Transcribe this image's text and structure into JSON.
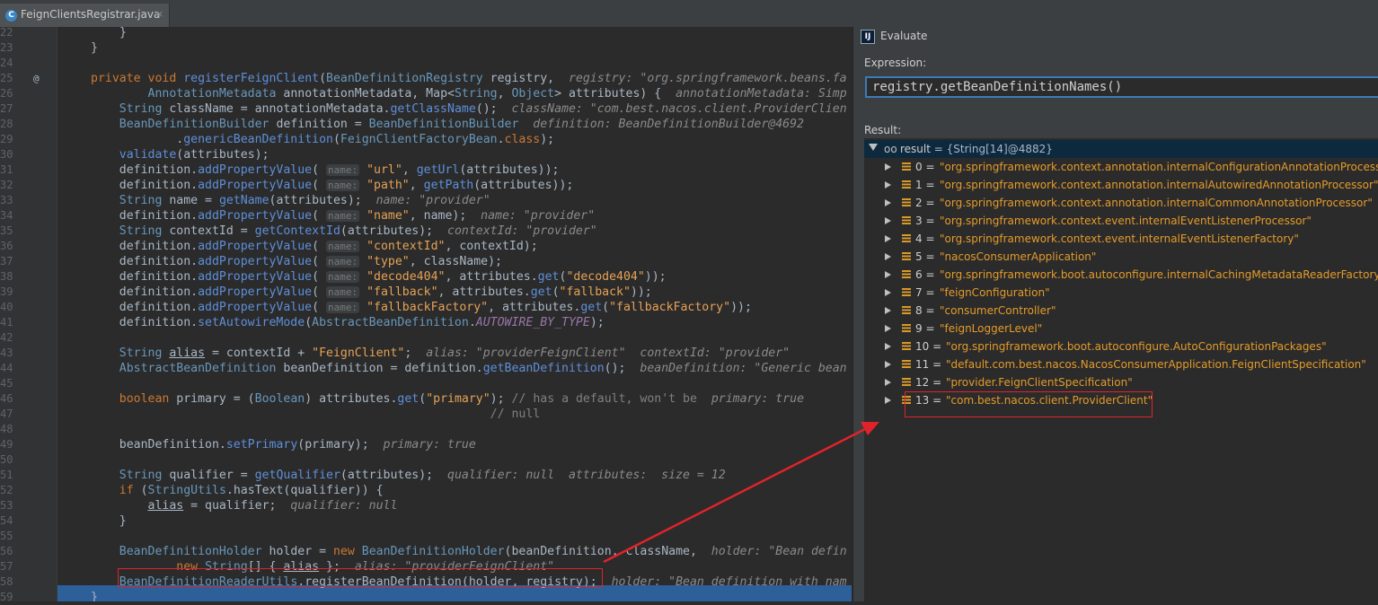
{
  "editor": {
    "tab_title": "FeignClientsRegistrar.java",
    "tab_icon_letter": "C",
    "tab_close": "×",
    "at_marker": "@",
    "lines": [
      {
        "n": "22",
        "html": "<span>}</span>"
      },
      {
        "n": "23",
        "html": "<span>}</span>"
      },
      {
        "n": "24",
        "html": ""
      },
      {
        "n": "25",
        "html": "<span class='kw'>private void </span><span class='fn'>registerFeignClient</span>(<span class='typ'>BeanDefinitionRegistry</span> registry,  <span class='it'>registry: \"org.springframework.beans.fa</span>"
      },
      {
        "n": "26",
        "html": "        <span class='typ'>AnnotationMetadata</span> annotationMetadata, Map&lt;<span class='typ'>String</span>, <span class='typ'>Object</span>&gt; attributes) {  <span class='it'>annotationMetadata: Simp</span>"
      },
      {
        "n": "27",
        "html": "    <span class='typ'>String</span> className = annotationMetadata.<span class='fn'>getClassName</span>();  <span class='it'>className: \"com.best.nacos.client.ProviderClien</span>"
      },
      {
        "n": "28",
        "html": "    <span class='typ'>BeanDefinitionBuilder</span> definition = <span class='typ'>BeanDefinitionBuilder</span>  <span class='it'>definition: BeanDefinitionBuilder@4692</span>"
      },
      {
        "n": "29",
        "html": "            .<span class='fn'>genericBeanDefinition</span>(<span class='typ'>FeignClientFactoryBean</span>.<span class='kw'>class</span>);"
      },
      {
        "n": "30",
        "html": "    <span class='fn'>validate</span>(attributes);"
      },
      {
        "n": "31",
        "html": "    definition.<span class='fn'>addPropertyValue</span>( <span class='hint'>name:</span> <span class='str'>\"url\"</span>, <span class='fn'>getUrl</span>(attributes));"
      },
      {
        "n": "32",
        "html": "    definition.<span class='fn'>addPropertyValue</span>( <span class='hint'>name:</span> <span class='str'>\"path\"</span>, <span class='fn'>getPath</span>(attributes));"
      },
      {
        "n": "33",
        "html": "    <span class='typ'>String</span> name = <span class='fn'>getName</span>(attributes);  <span class='it'>name: \"provider\"</span>"
      },
      {
        "n": "34",
        "html": "    definition.<span class='fn'>addPropertyValue</span>( <span class='hint'>name:</span> <span class='str'>\"name\"</span>, name);  <span class='it'>name: \"provider\"</span>"
      },
      {
        "n": "35",
        "html": "    <span class='typ'>String</span> contextId = <span class='fn'>getContextId</span>(attributes);  <span class='it'>contextId: \"provider\"</span>"
      },
      {
        "n": "36",
        "html": "    definition.<span class='fn'>addPropertyValue</span>( <span class='hint'>name:</span> <span class='str'>\"contextId\"</span>, contextId);"
      },
      {
        "n": "37",
        "html": "    definition.<span class='fn'>addPropertyValue</span>( <span class='hint'>name:</span> <span class='str'>\"type\"</span>, className);"
      },
      {
        "n": "38",
        "html": "    definition.<span class='fn'>addPropertyValue</span>( <span class='hint'>name:</span> <span class='str'>\"decode404\"</span>, attributes.<span class='fn'>get</span>(<span class='str'>\"decode404\"</span>));"
      },
      {
        "n": "39",
        "html": "    definition.<span class='fn'>addPropertyValue</span>( <span class='hint'>name:</span> <span class='str'>\"fallback\"</span>, attributes.<span class='fn'>get</span>(<span class='str'>\"fallback\"</span>));"
      },
      {
        "n": "40",
        "html": "    definition.<span class='fn'>addPropertyValue</span>( <span class='hint'>name:</span> <span class='str'>\"fallbackFactory\"</span>, attributes.<span class='fn'>get</span>(<span class='str'>\"fallbackFactory\"</span>));"
      },
      {
        "n": "41",
        "html": "    definition.<span class='fn'>setAutowireMode</span>(<span class='typ'>AbstractBeanDefinition</span>.<span class='cst'>AUTOWIRE_BY_TYPE</span>);"
      },
      {
        "n": "42",
        "html": ""
      },
      {
        "n": "43",
        "html": "    <span class='typ'>String</span> <span class='ul'>alias</span> = contextId + <span class='str'>\"FeignClient\"</span>;  <span class='it'>alias: \"providerFeignClient\"  contextId: \"provider\"</span>"
      },
      {
        "n": "44",
        "html": "    <span class='typ'>AbstractBeanDefinition</span> beanDefinition = definition.<span class='fn'>getBeanDefinition</span>();  <span class='it'>beanDefinition: \"Generic bean</span>"
      },
      {
        "n": "45",
        "html": ""
      },
      {
        "n": "46",
        "html": "    <span class='kw'>boolean</span> primary = (<span class='typ'>Boolean</span>) attributes.<span class='fn'>get</span>(<span class='str'>\"primary\"</span>); <span class='cm'>// has a default, won't be</span>  <span class='it'>primary: true</span>"
      },
      {
        "n": "47",
        "html": "                                                        <span class='cm'>// null</span>"
      },
      {
        "n": "48",
        "html": ""
      },
      {
        "n": "49",
        "html": "    beanDefinition.<span class='fn'>setPrimary</span>(primary);  <span class='it'>primary: true</span>"
      },
      {
        "n": "50",
        "html": ""
      },
      {
        "n": "51",
        "html": "    <span class='typ'>String</span> qualifier = <span class='fn'>getQualifier</span>(attributes);  <span class='it'>qualifier: null  attributes:  size = 12</span>"
      },
      {
        "n": "52",
        "html": "    <span class='kw'>if</span> (<span class='typ'>StringUtils</span>.hasText(qualifier)) {"
      },
      {
        "n": "53",
        "html": "        <span class='ul'>alias</span> = qualifier;  <span class='it'>qualifier: null</span>"
      },
      {
        "n": "54",
        "html": "    }"
      },
      {
        "n": "55",
        "html": ""
      },
      {
        "n": "56",
        "html": "    <span class='typ'>BeanDefinitionHolder</span> holder = <span class='kw'>new</span> <span class='typ'>BeanDefinitionHolder</span>(beanDefinition, className,  <span class='it'>holder: \"Bean defin</span>"
      },
      {
        "n": "57",
        "html": "            <span class='kw'>new</span> <span class='typ'>String</span>[] { <span class='ul'>alias</span> };  <span class='it'>alias: \"providerFeignClient\"</span>"
      },
      {
        "n": "58",
        "html": "    <span class='typ'>BeanDefinitionReaderUtils</span>.registerBeanDefinition(holder, registry);  <span class='it'>holder: \"Bean definition with nam</span>"
      },
      {
        "n": "59",
        "html": "}"
      }
    ]
  },
  "evaluate": {
    "title": "Evaluate",
    "app_icon_text": "IJ",
    "expression_label": "Expression:",
    "expression_value": "registry.getBeanDefinitionNames()",
    "result_label": "Result:",
    "result_icon": "oo",
    "result_name": "result",
    "result_value": " = {String[14]@4882}",
    "items": [
      {
        "index": "0 = ",
        "value": "\"org.springframework.context.annotation.internalConfigurationAnnotationProcessor\""
      },
      {
        "index": "1 = ",
        "value": "\"org.springframework.context.annotation.internalAutowiredAnnotationProcessor\""
      },
      {
        "index": "2 = ",
        "value": "\"org.springframework.context.annotation.internalCommonAnnotationProcessor\""
      },
      {
        "index": "3 = ",
        "value": "\"org.springframework.context.event.internalEventListenerProcessor\""
      },
      {
        "index": "4 = ",
        "value": "\"org.springframework.context.event.internalEventListenerFactory\""
      },
      {
        "index": "5 = ",
        "value": "\"nacosConsumerApplication\""
      },
      {
        "index": "6 = ",
        "value": "\"org.springframework.boot.autoconfigure.internalCachingMetadataReaderFactory\""
      },
      {
        "index": "7 = ",
        "value": "\"feignConfiguration\""
      },
      {
        "index": "8 = ",
        "value": "\"consumerController\""
      },
      {
        "index": "9 = ",
        "value": "\"feignLoggerLevel\""
      },
      {
        "index": "10 = ",
        "value": "\"org.springframework.boot.autoconfigure.AutoConfigurationPackages\""
      },
      {
        "index": "11 = ",
        "value": "\"default.com.best.nacos.NacosConsumerApplication.FeignClientSpecification\""
      },
      {
        "index": "12 = ",
        "value": "\"provider.FeignClientSpecification\""
      },
      {
        "index": "13 = ",
        "value": "\"com.best.nacos.client.ProviderClient\""
      }
    ]
  },
  "colors": {
    "accent_highlight": "#e0232a",
    "execution_line": "#2d6099",
    "string_value": "#e49b2b"
  }
}
